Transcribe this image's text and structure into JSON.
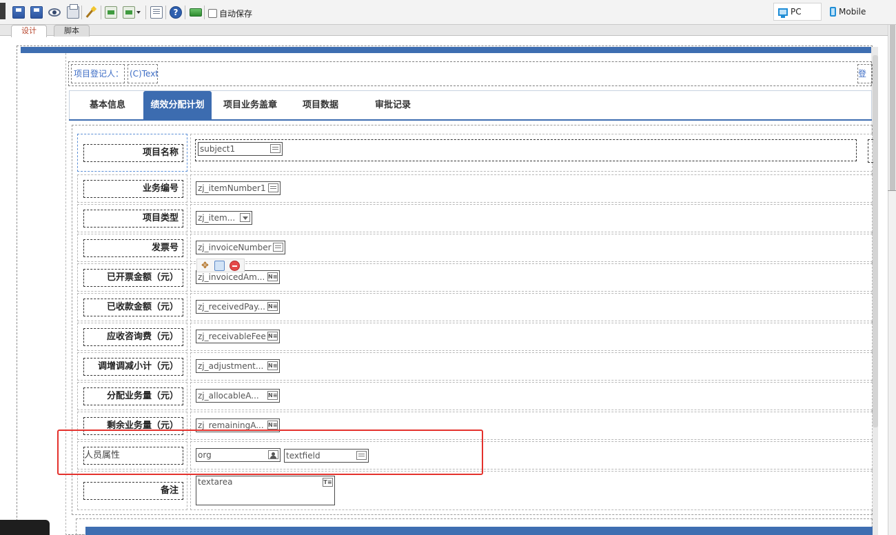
{
  "toolbar": {
    "autosave_label": "自动保存",
    "device_pc": "PC",
    "device_mobile": "Mobile"
  },
  "editor_tabs": [
    "设计",
    "脚本"
  ],
  "registrant": {
    "label": "项目登记人：",
    "value": "(C)Text",
    "right_label": "登记"
  },
  "form_tabs": [
    "基本信息",
    "绩效分配计划",
    "项目业务盖章",
    "项目数据",
    "审批记录"
  ],
  "active_form_tab": "绩效分配计划",
  "rows": [
    {
      "label": "项目名称",
      "controls": [
        {
          "value": "subject1",
          "badge": "edit"
        }
      ]
    },
    {
      "label": "业务编号",
      "controls": [
        {
          "value": "zj_itemNumber1",
          "badge": "edit"
        }
      ]
    },
    {
      "label": "项目类型",
      "controls": [
        {
          "value": "zj_item...",
          "badge": "dropdown"
        }
      ]
    },
    {
      "label": "发票号",
      "controls": [
        {
          "value": "zj_invoiceNumber",
          "badge": "edit"
        }
      ]
    },
    {
      "label": "已开票金额（元）",
      "controls": [
        {
          "value": "zj_invoicedAm...",
          "badge": "N"
        }
      ]
    },
    {
      "label": "已收款金额（元）",
      "controls": [
        {
          "value": "zj_receivedPay...",
          "badge": "N"
        }
      ]
    },
    {
      "label": "应收咨询费（元）",
      "controls": [
        {
          "value": "zj_receivableFee",
          "badge": "N"
        }
      ]
    },
    {
      "label": "调增调减小计（元）",
      "controls": [
        {
          "value": "zj_adjustment...",
          "badge": "N"
        }
      ]
    },
    {
      "label": "分配业务量（元）",
      "controls": [
        {
          "value": "zj_allocableA...",
          "badge": "N"
        }
      ]
    },
    {
      "label": "剩余业务量（元）",
      "controls": [
        {
          "value": "zj_remainingA...",
          "badge": "N"
        }
      ]
    },
    {
      "label": "人员属性",
      "controls": [
        {
          "value": "org",
          "badge": "user"
        },
        {
          "value": "textfield",
          "badge": "edit"
        }
      ]
    },
    {
      "label": "备注",
      "controls": [
        {
          "value": "textarea",
          "badge": "T"
        }
      ]
    }
  ],
  "badge_text": {
    "N": "N≡",
    "T": "T≡"
  },
  "colors": {
    "accent": "#3c6cb0",
    "highlight": "#e4312c",
    "link_text": "#3c6cc5"
  }
}
